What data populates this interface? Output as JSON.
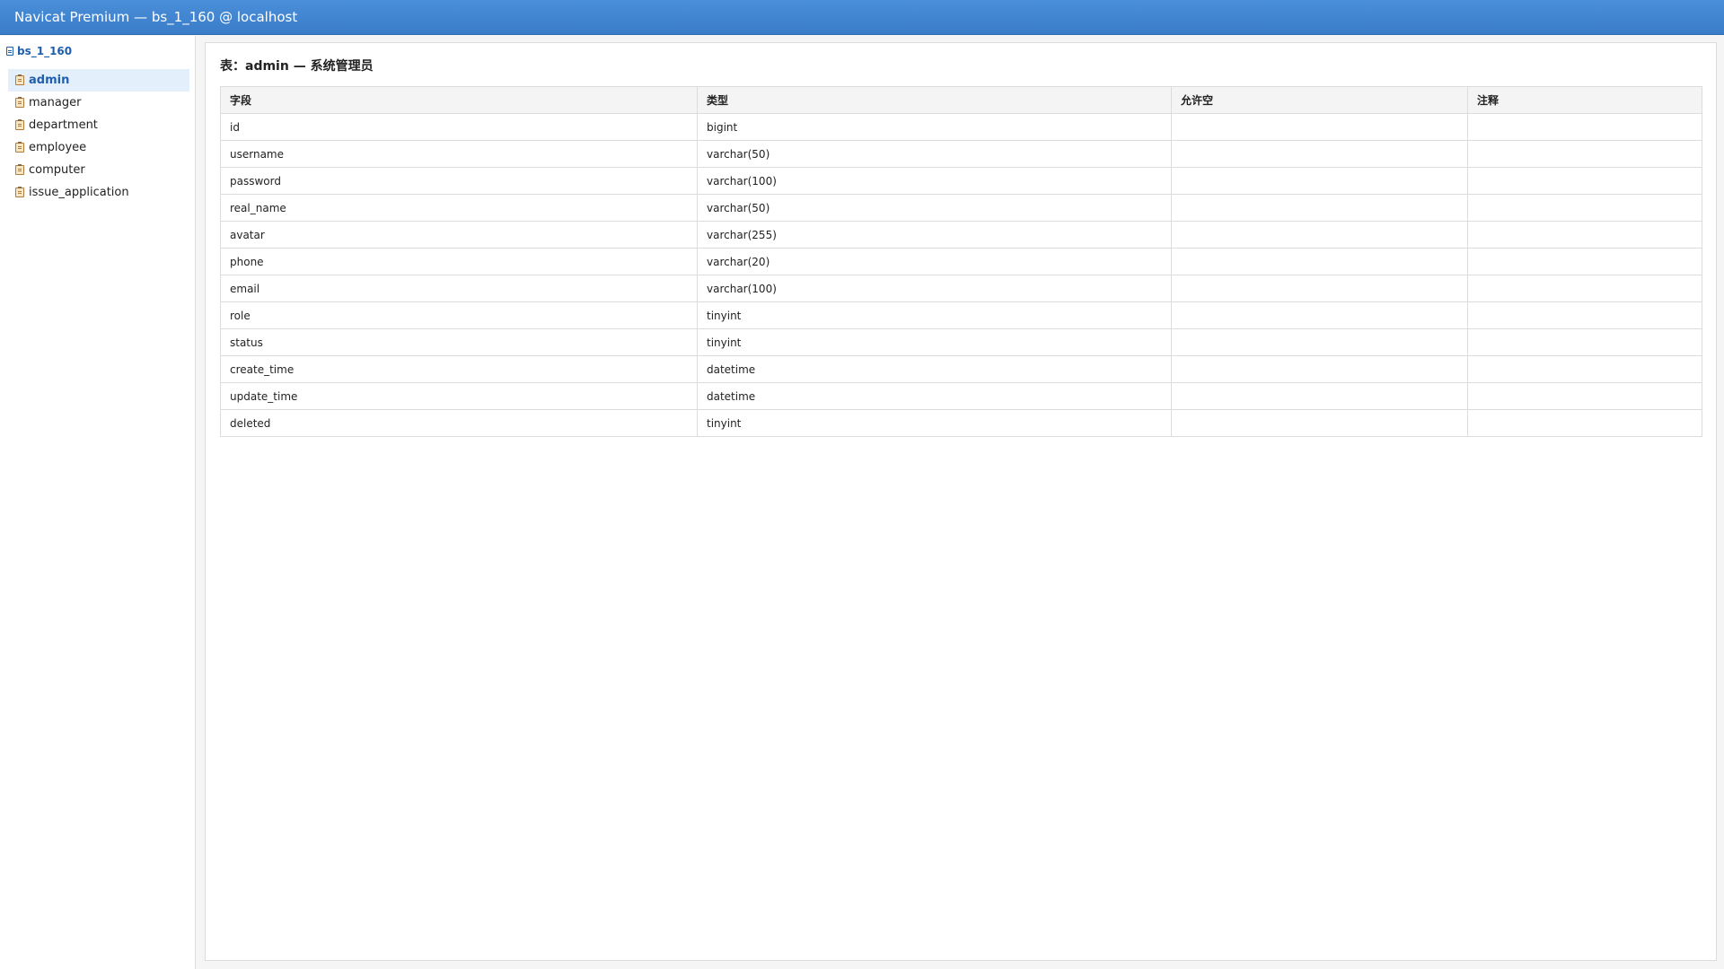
{
  "window": {
    "title": "Navicat Premium — bs_1_160 @ localhost"
  },
  "sidebar": {
    "database": {
      "name": "bs_1_160",
      "icon": "database-icon"
    },
    "tables": [
      {
        "label": "admin",
        "icon": "table-icon",
        "active": true
      },
      {
        "label": "manager",
        "icon": "table-icon",
        "active": false
      },
      {
        "label": "department",
        "icon": "table-icon",
        "active": false
      },
      {
        "label": "employee",
        "icon": "table-icon",
        "active": false
      },
      {
        "label": "computer",
        "icon": "table-icon",
        "active": false
      },
      {
        "label": "issue_application",
        "icon": "table-icon",
        "active": false
      }
    ]
  },
  "main": {
    "title": "表：admin — 系统管理员",
    "columns": [
      "字段",
      "类型",
      "允许空",
      "注释"
    ],
    "rows": [
      {
        "field": "id",
        "type": "bigint",
        "nullable": "",
        "comment": ""
      },
      {
        "field": "username",
        "type": "varchar(50)",
        "nullable": "",
        "comment": ""
      },
      {
        "field": "password",
        "type": "varchar(100)",
        "nullable": "",
        "comment": ""
      },
      {
        "field": "real_name",
        "type": "varchar(50)",
        "nullable": "",
        "comment": ""
      },
      {
        "field": "avatar",
        "type": "varchar(255)",
        "nullable": "",
        "comment": ""
      },
      {
        "field": "phone",
        "type": "varchar(20)",
        "nullable": "",
        "comment": ""
      },
      {
        "field": "email",
        "type": "varchar(100)",
        "nullable": "",
        "comment": ""
      },
      {
        "field": "role",
        "type": "tinyint",
        "nullable": "",
        "comment": ""
      },
      {
        "field": "status",
        "type": "tinyint",
        "nullable": "",
        "comment": ""
      },
      {
        "field": "create_time",
        "type": "datetime",
        "nullable": "",
        "comment": ""
      },
      {
        "field": "update_time",
        "type": "datetime",
        "nullable": "",
        "comment": ""
      },
      {
        "field": "deleted",
        "type": "tinyint",
        "nullable": "",
        "comment": ""
      }
    ]
  },
  "colors": {
    "titlebar": "#3a7cc8",
    "accent": "#1f5fae",
    "active_row_bg": "#e3f0fc"
  }
}
